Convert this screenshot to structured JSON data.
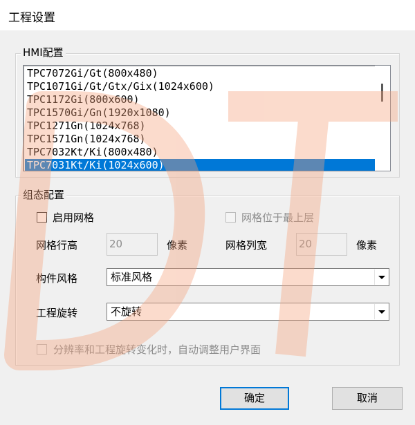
{
  "window": {
    "title": "工程设置"
  },
  "hmi_group": {
    "legend": "HMI配置",
    "items": [
      "TPC7072Gi/Gt(800x480)",
      "TPC1071Gi/Gt/Gtx/Gix(1024x600)",
      "TPC1172Gi(800x600)",
      "TPC1570Gi/Gn(1920x1080)",
      "TPC1271Gn(1024x768)",
      "TPC1571Gn(1024x768)",
      "TPC7032Kt/Ki(800x480)",
      "TPC7031Kt/Ki(1024x600)"
    ],
    "selected_index": 7
  },
  "config_group": {
    "legend": "组态配置",
    "enable_grid_label": "启用网格",
    "grid_top_label": "网格位于最上层",
    "row_height_label": "网格行高",
    "row_height_value": "20",
    "row_unit": "像素",
    "col_width_label": "网格列宽",
    "col_width_value": "20",
    "col_unit": "像素",
    "style_label": "构件风格",
    "style_value": "标准风格",
    "rotate_label": "工程旋转",
    "rotate_value": "不旋转",
    "auto_adjust_label": "分辨率和工程旋转变化时，自动调整用户界面"
  },
  "buttons": {
    "ok": "确定",
    "cancel": "取消"
  },
  "watermark": {
    "text": "DT",
    "color": "#f5a07a"
  }
}
